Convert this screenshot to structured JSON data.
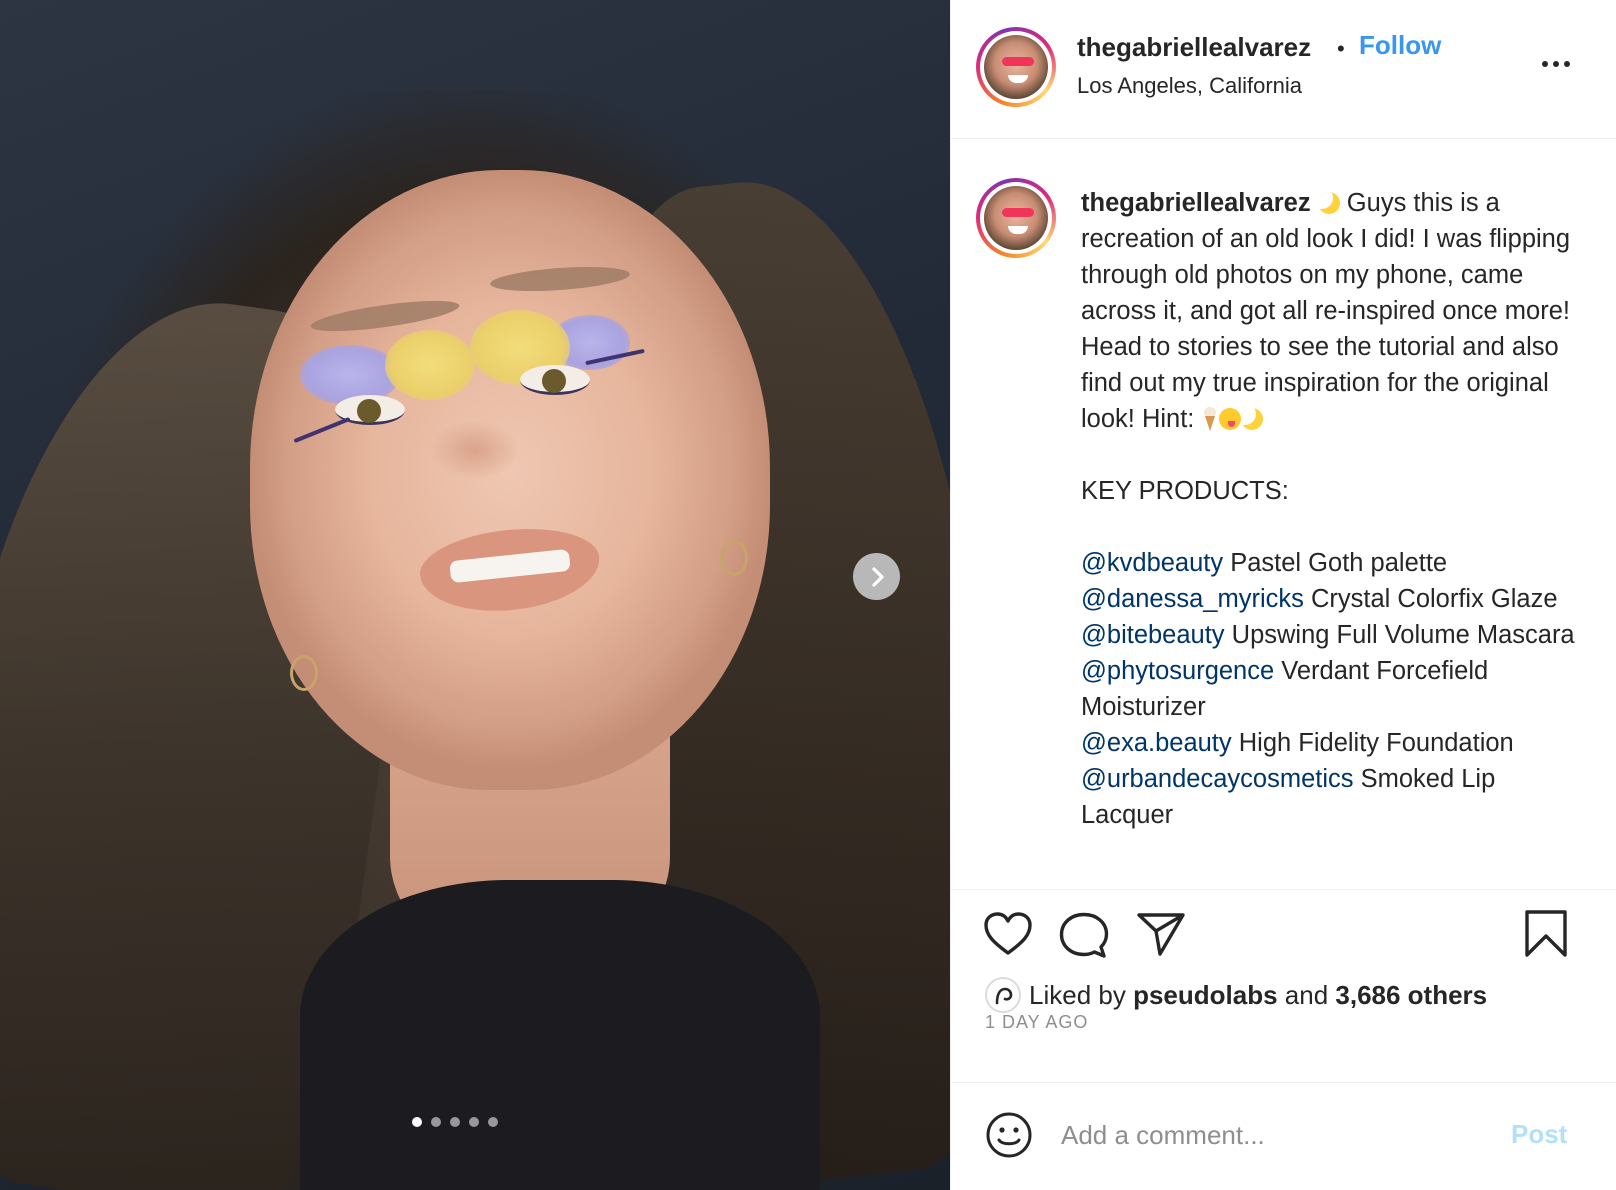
{
  "post": {
    "carousel": {
      "slide_count": 5,
      "active_index": 0
    },
    "header": {
      "username": "thegabriellealvarez",
      "bullet": "•",
      "follow_label": "Follow",
      "location": "Los Angeles, California"
    },
    "caption": {
      "author": "thegabriellealvarez",
      "intro": " Guys this is a recreation of an old look I did! I was flipping through old photos on my phone, came across it, and got all re-inspired once more! Head to stories to see the tutorial and also find out my true inspiration for the original look! Hint: ",
      "heading": "KEY PRODUCTS:",
      "products": [
        {
          "handle": "@kvdbeauty",
          "text": " Pastel Goth palette"
        },
        {
          "handle": "@danessa_myricks",
          "text": " Crystal Colorfix Glaze"
        },
        {
          "handle": "@bitebeauty",
          "text": " Upswing Full Volume Mascara"
        },
        {
          "handle": "@phytosurgence",
          "text": " Verdant Forcefield Moisturizer"
        },
        {
          "handle": "@exa.beauty",
          "text": " High Fidelity Foundation"
        },
        {
          "handle": "@urbandecaycosmetics",
          "text": " Smoked Lip Lacquer"
        }
      ]
    },
    "likes": {
      "prefix": "Liked by ",
      "user": "pseudolabs",
      "joiner": " and ",
      "count": "3,686 others"
    },
    "timestamp": "1 DAY AGO",
    "comment_box": {
      "placeholder": "Add a comment...",
      "post_label": "Post"
    }
  },
  "colors": {
    "accent": "#3897f0",
    "mention": "#003569",
    "muted": "#8e8e8e",
    "post_disabled": "#b2dffc"
  },
  "icons": [
    "chevron-right-icon",
    "more-icon",
    "heart-icon",
    "comment-icon",
    "send-icon",
    "bookmark-icon",
    "smiley-icon",
    "moon-emoji",
    "ice-cream-emoji",
    "yum-face-emoji"
  ]
}
